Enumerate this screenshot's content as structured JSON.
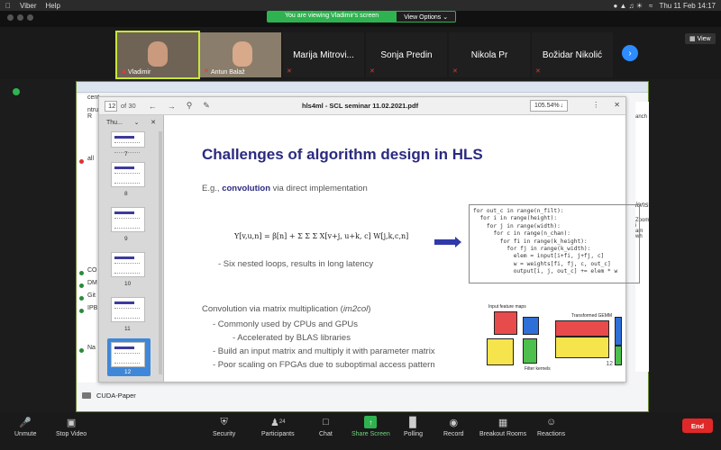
{
  "menubar": {
    "app": "Viber",
    "help": "Help",
    "datetime": "Thu 11 Feb  14:17"
  },
  "banner": {
    "viewing_text": "You are viewing Vladimir's screen",
    "view_options": "View Options ⌄"
  },
  "gallery": {
    "view_label": "View",
    "participants": [
      {
        "name": "Vladimir",
        "video": true
      },
      {
        "name": "Antun Balaž",
        "video": true
      },
      {
        "name": "Marija Mitrovi...",
        "video": false
      },
      {
        "name": "Sonja Predin",
        "video": false
      },
      {
        "name": "Nikola Pr",
        "video": false
      },
      {
        "name": "Božidar Nikolić",
        "video": false
      }
    ]
  },
  "pdf": {
    "page_current": "12",
    "page_total": "of 30",
    "title": "hls4ml - SCL seminar 11.02.2021.pdf",
    "zoom": "105.54%",
    "thumb_header": "Thu...",
    "thumb_numbers": [
      "7",
      "8",
      "9",
      "10",
      "11",
      "12"
    ]
  },
  "slide": {
    "title": "Challenges of algorithm design in HLS",
    "eg_prefix": "E.g., ",
    "eg_bold": "convolution",
    "eg_suffix": " via direct implementation",
    "formula": "Y[v,u,n] = β[n] + Σ Σ Σ X[v+j, u+k, c] W[j,k,c,n]",
    "bullet1": "-   Six nested loops, results in long latency",
    "code": "for out_c in range(n_filt):\n  for i in range(height):\n    for j in range(width):\n      for c in range(n_chan):\n        for fi in range(k_height):\n          for fj in range(k_width):\n            elem = input[i+fi, j+fj, c]\n            w = weights[fi, fj, c, out_c]\n            output[i, j, out_c] += elem * w",
    "im2col_prefix": "Convolution via matrix multiplication (",
    "im2col_italic": "im2col",
    "im2col_suffix": ")",
    "bullet2": "-   Commonly used by CPUs and GPUs",
    "bullet2a": "-   Accelerated by BLAS libraries",
    "bullet3": "-   Build an input matrix and multiply it with parameter matrix",
    "bullet4": "-   Poor scaling on FPGAs due to suboptimal access pattern",
    "diagram_input": "Input feature maps",
    "diagram_gemm": "Transformed GEMM",
    "diagram_filter": "Filter kernels",
    "page": "12"
  },
  "background_app": {
    "cuda_paper": "CUDA-Paper",
    "sidebar_labels": [
      "cent",
      "ntru R",
      "all",
      "CO",
      "DM",
      "Git",
      "IPB",
      "Na"
    ],
    "right_labels": [
      "anch",
      "ions",
      "Zoom i",
      "am wh"
    ]
  },
  "toolbar": {
    "unmute": "Unmute",
    "stop_video": "Stop Video",
    "security": "Security",
    "participants": "Participants",
    "participants_count": "24",
    "chat": "Chat",
    "share_screen": "Share Screen",
    "polling": "Polling",
    "record": "Record",
    "breakout": "Breakout Rooms",
    "reactions": "Reactions",
    "end": "End"
  },
  "colors": {
    "accent_green": "#2fb350",
    "end_red": "#e02828",
    "slide_title_blue": "#2b2a7f",
    "zoom_blue": "#2d8cff"
  }
}
